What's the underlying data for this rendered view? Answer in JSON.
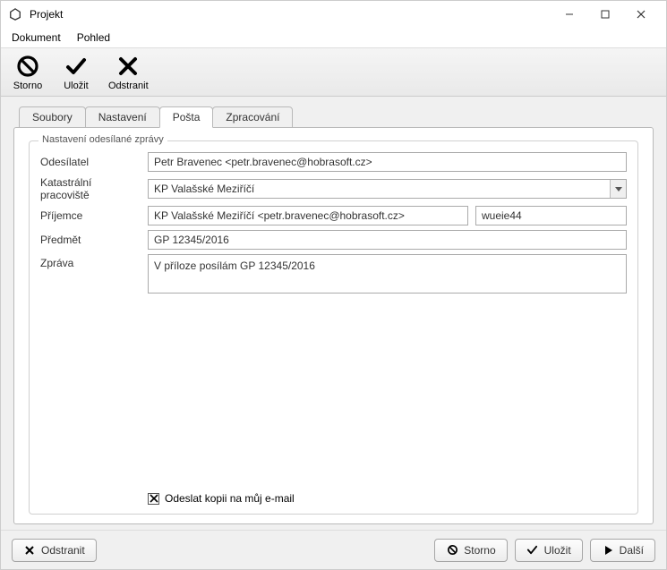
{
  "window": {
    "title": "Projekt"
  },
  "menubar": {
    "document": "Dokument",
    "view": "Pohled"
  },
  "toolbar": {
    "cancel_label": "Storno",
    "save_label": "Uložit",
    "delete_label": "Odstranit"
  },
  "tabs": {
    "files": "Soubory",
    "settings": "Nastavení",
    "mail": "Pošta",
    "processing": "Zpracování"
  },
  "group": {
    "title": "Nastavení odesílané zprávy"
  },
  "form": {
    "sender_label": "Odesílatel",
    "sender_value": "Petr Bravenec <petr.bravenec@hobrasoft.cz>",
    "office_label": "Katastrální pracoviště",
    "office_value": "KP Valašské Meziříčí",
    "recipient_label": "Příjemce",
    "recipient_value": "KP Valašské Meziříčí <petr.bravenec@hobrasoft.cz>",
    "recipient_code": "wueie44",
    "subject_label": "Předmět",
    "subject_value": "GP 12345/2016",
    "message_label": "Zpráva",
    "message_value": "V příloze posílám GP 12345/2016",
    "copy_label": "Odeslat kopii na můj e-mail",
    "copy_checked": true
  },
  "footer": {
    "delete_label": "Odstranit",
    "cancel_label": "Storno",
    "save_label": "Uložit",
    "next_label": "Další"
  }
}
